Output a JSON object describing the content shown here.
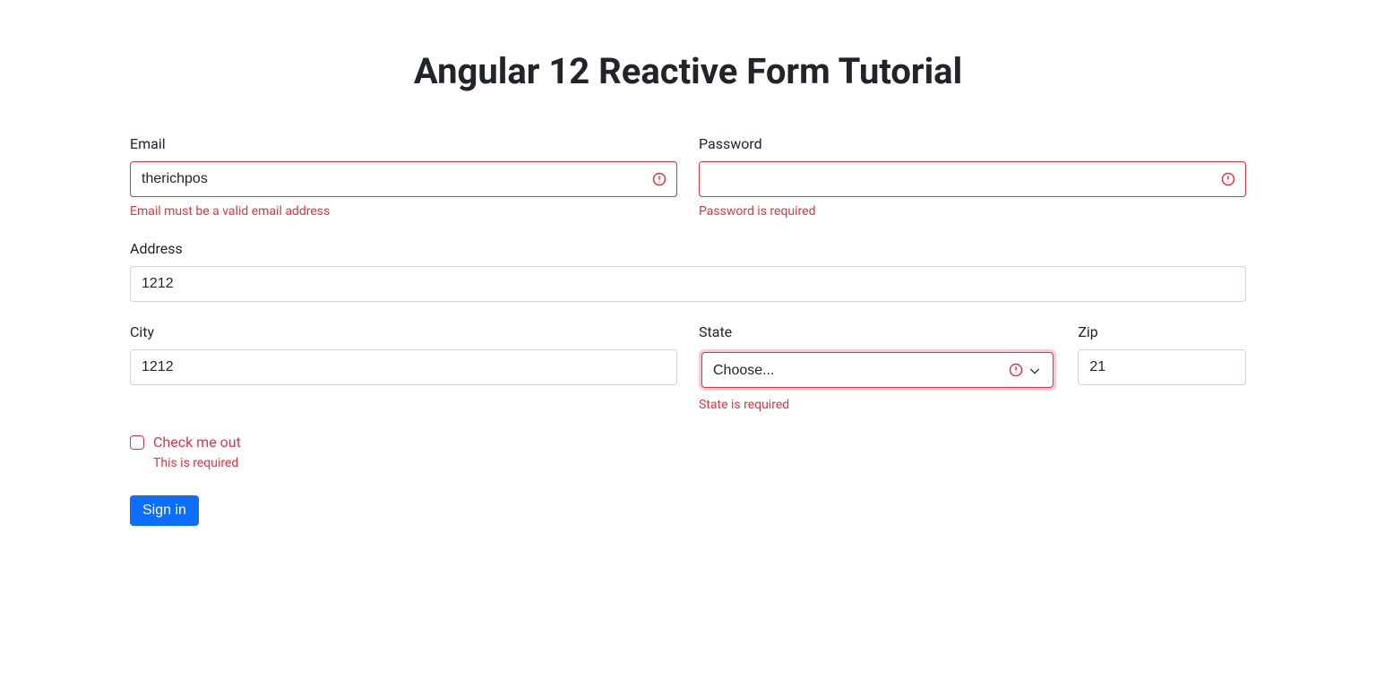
{
  "title": "Angular 12 Reactive Form Tutorial",
  "form": {
    "email": {
      "label": "Email",
      "value": "therichpos",
      "error": "Email must be a valid email address"
    },
    "password": {
      "label": "Password",
      "value": "",
      "error": "Password is required"
    },
    "address": {
      "label": "Address",
      "value": "1212"
    },
    "city": {
      "label": "City",
      "value": "1212"
    },
    "state": {
      "label": "State",
      "placeholder": "Choose...",
      "error": "State is required"
    },
    "zip": {
      "label": "Zip",
      "value": "21"
    },
    "check": {
      "label": "Check me out",
      "error": "This is required"
    },
    "submit": {
      "label": "Sign in"
    }
  }
}
